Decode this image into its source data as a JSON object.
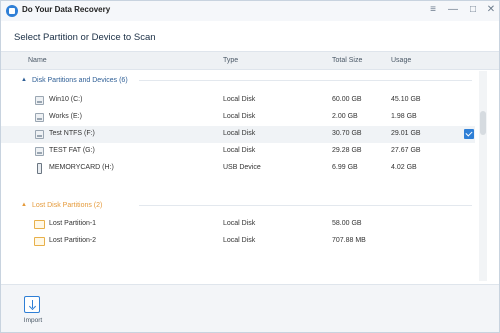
{
  "window": {
    "title": "Do Your Data Recovery",
    "controls": [
      "≡",
      "—",
      "□",
      "✕"
    ]
  },
  "page_title": "Select Partition or Device to Scan",
  "columns": {
    "name": "Name",
    "type": "Type",
    "total_size": "Total Size",
    "usage": "Usage"
  },
  "groups": {
    "disk": {
      "label": "Disk Partitions and Devices (6)",
      "rows": [
        {
          "name": "Win10 (C:)",
          "type": "Local Disk",
          "total_size": "60.00 GB",
          "usage": "45.10 GB",
          "icon": "drive-icon",
          "selected": false
        },
        {
          "name": "Works (E:)",
          "type": "Local Disk",
          "total_size": "2.00 GB",
          "usage": "1.98 GB",
          "icon": "drive-icon",
          "selected": false
        },
        {
          "name": "Test NTFS (F:)",
          "type": "Local Disk",
          "total_size": "30.70 GB",
          "usage": "29.01 GB",
          "icon": "drive-icon",
          "selected": true
        },
        {
          "name": "TEST FAT (G:)",
          "type": "Local Disk",
          "total_size": "29.28 GB",
          "usage": "27.67 GB",
          "icon": "drive-icon",
          "selected": false
        },
        {
          "name": "MEMORYCARD (H:)",
          "type": "USB Device",
          "total_size": "6.99 GB",
          "usage": "4.02 GB",
          "icon": "memory-card-icon",
          "selected": false
        }
      ]
    },
    "lost": {
      "label": "Lost Disk Partitions (2)",
      "rows": [
        {
          "name": "Lost Partition-1",
          "type": "Local Disk",
          "total_size": "58.00 GB",
          "usage": "",
          "icon": "lost-partition-icon"
        },
        {
          "name": "Lost Partition-2",
          "type": "Local Disk",
          "total_size": "707.88 MB",
          "usage": "",
          "icon": "lost-partition-icon"
        }
      ]
    }
  },
  "footer": {
    "import_label": "Import"
  },
  "colors": {
    "accent": "#2f7fd6",
    "lost_group": "#e59a3a",
    "group": "#2f5f96"
  }
}
